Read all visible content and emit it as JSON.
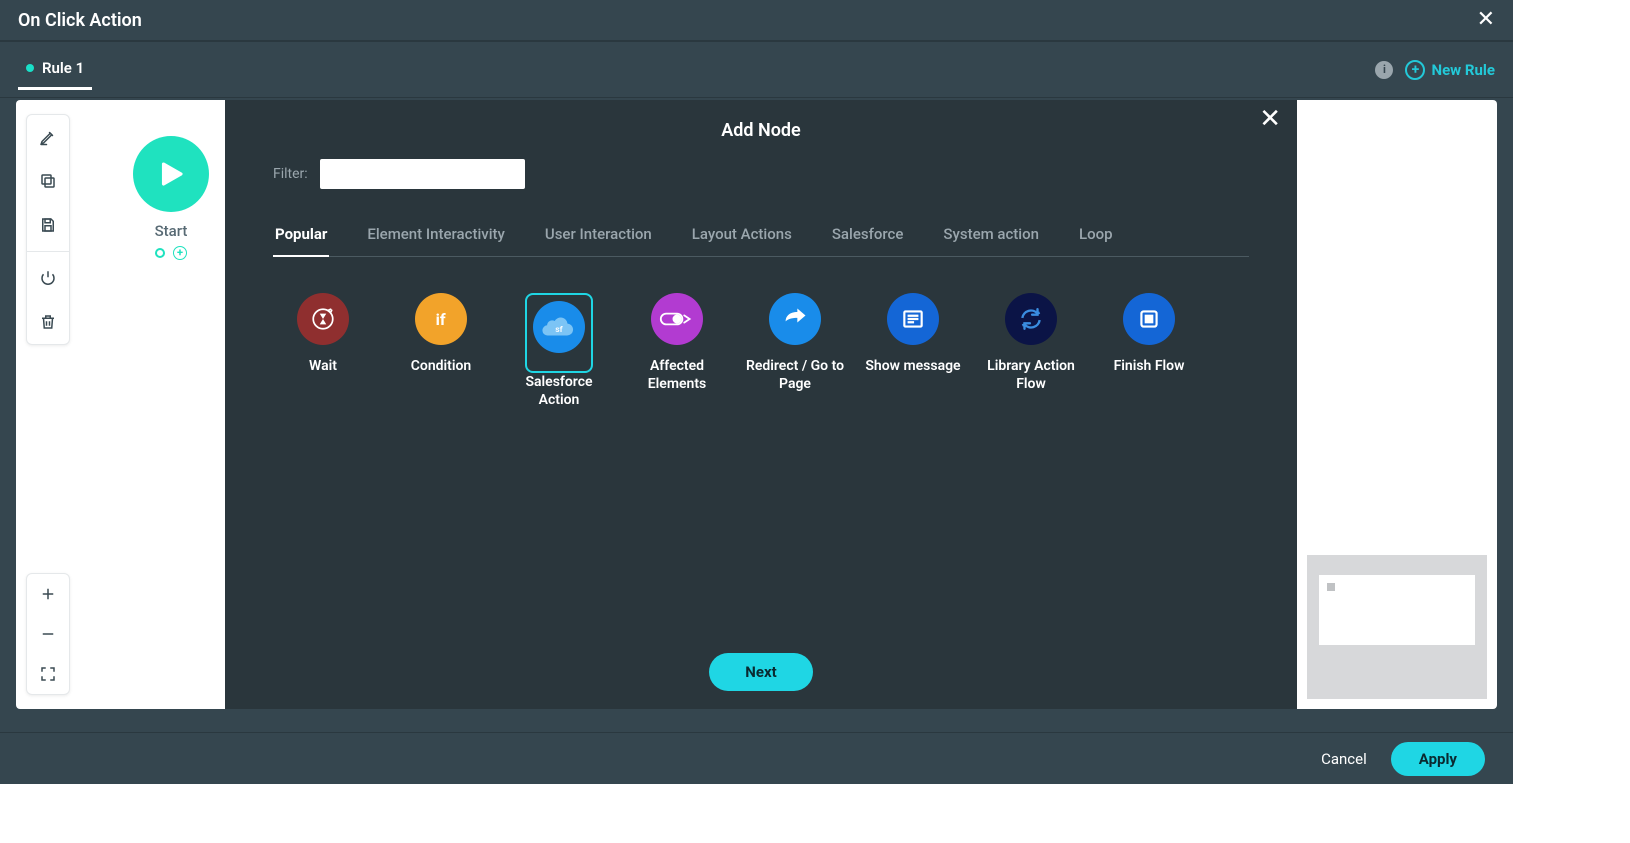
{
  "titlebar": {
    "title": "On Click Action"
  },
  "rules": {
    "active_tab": "Rule 1",
    "new_rule_label": "New Rule"
  },
  "canvas": {
    "start_label": "Start"
  },
  "panel": {
    "title": "Add Node",
    "filter_label": "Filter:",
    "filter_value": "",
    "tabs": [
      "Popular",
      "Element Interactivity",
      "User Interaction",
      "Layout Actions",
      "Salesforce",
      "System action",
      "Loop"
    ],
    "active_tab": "Popular",
    "nodes": [
      {
        "id": "wait",
        "label": "Wait"
      },
      {
        "id": "condition",
        "label": "Condition"
      },
      {
        "id": "salesforce",
        "label": "Salesforce Action",
        "selected": true
      },
      {
        "id": "affected",
        "label": "Affected Elements"
      },
      {
        "id": "redirect",
        "label": "Redirect / Go to Page"
      },
      {
        "id": "show-message",
        "label": "Show message"
      },
      {
        "id": "library-flow",
        "label": "Library Action Flow"
      },
      {
        "id": "finish",
        "label": "Finish Flow"
      }
    ],
    "next_label": "Next"
  },
  "footer": {
    "cancel": "Cancel",
    "apply": "Apply"
  }
}
